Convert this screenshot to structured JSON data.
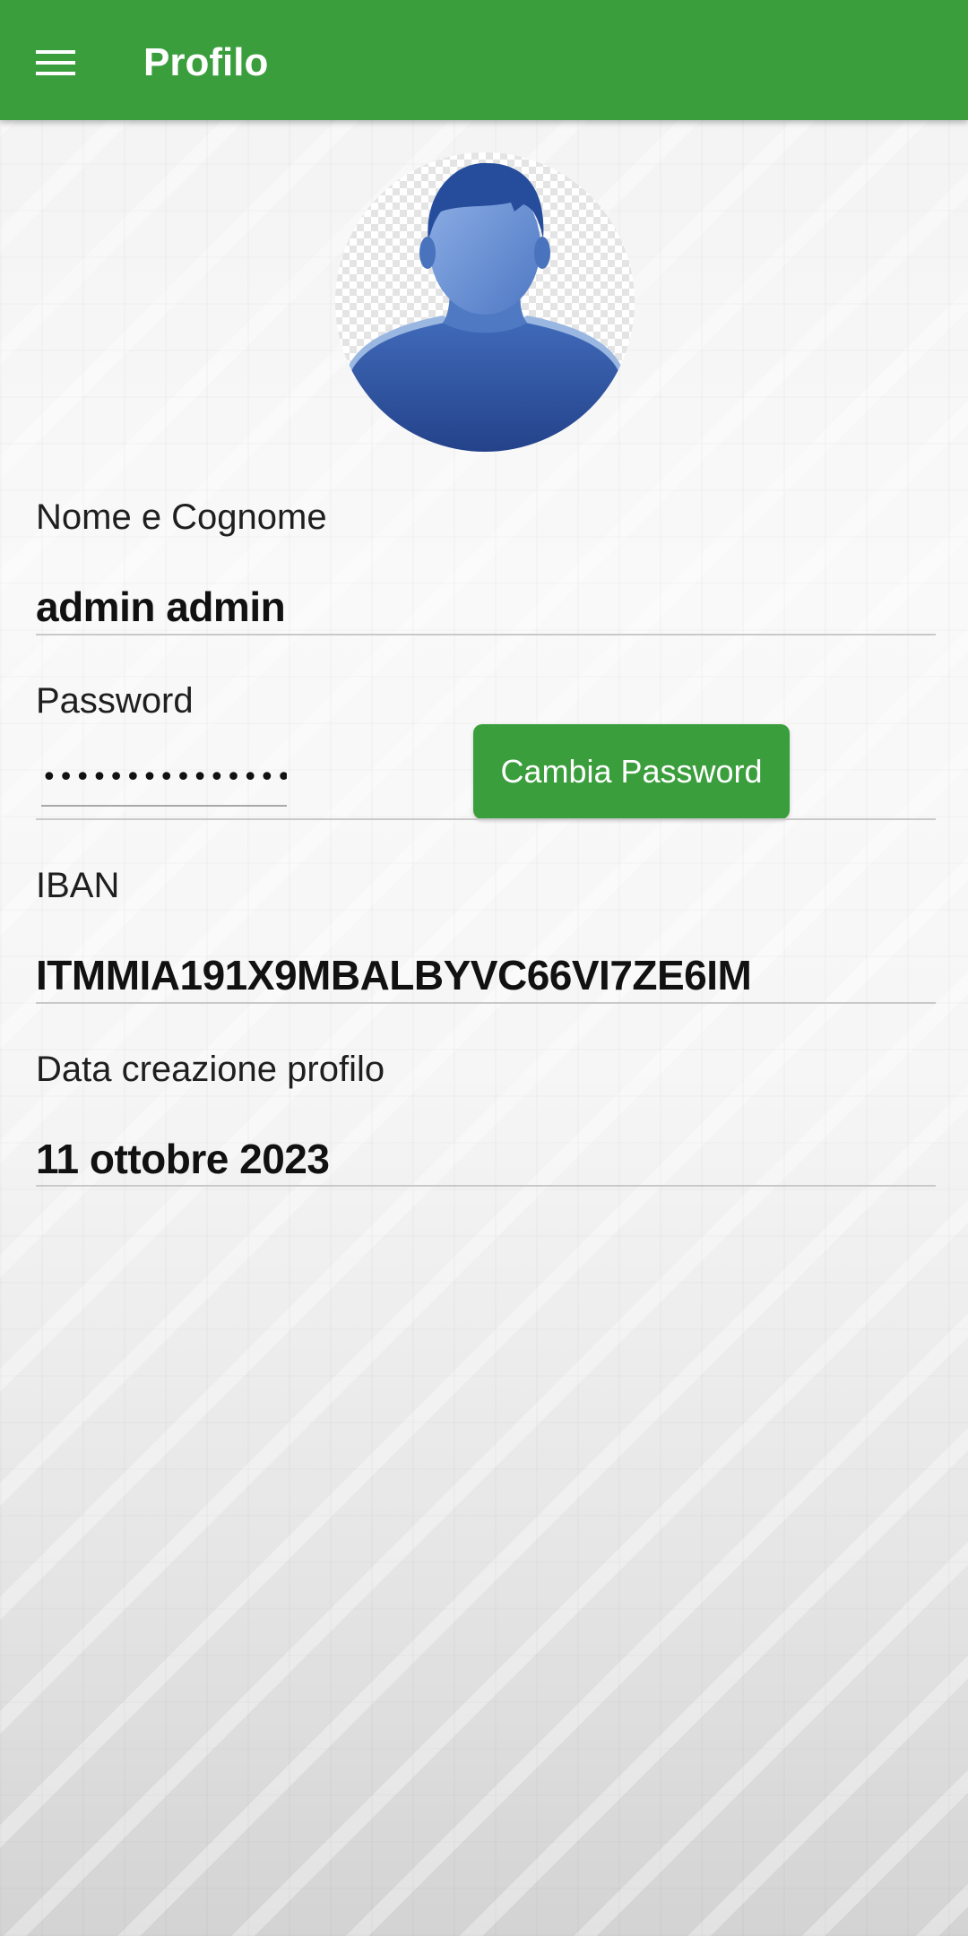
{
  "colors": {
    "primary": "#3b9e3d",
    "on_primary": "#ffffff",
    "avatar_blue": "#2f5aa8"
  },
  "appbar": {
    "title": "Profilo",
    "menu_icon": "hamburger-menu-icon"
  },
  "avatar": {
    "icon": "user-silhouette-icon"
  },
  "profile": {
    "name_label": "Nome e Cognome",
    "name_value": "admin admin",
    "password_label": "Password",
    "password_value": "••••••••••••••••",
    "change_password_label": "Cambia Password",
    "iban_label": "IBAN",
    "iban_value": "ITMMIA191X9MBALBYVC66VI7ZE6IM",
    "created_label": "Data creazione profilo",
    "created_value": "11 ottobre 2023"
  }
}
